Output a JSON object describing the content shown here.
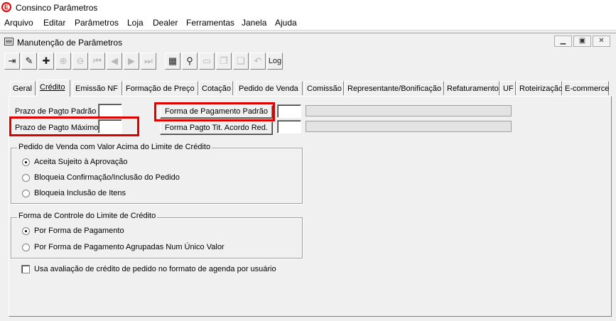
{
  "app": {
    "logo_letter": "E",
    "title": "Consinco Parâmetros"
  },
  "menu": [
    "Arquivo",
    "Editar",
    "Parâmetros",
    "Loja",
    "Dealer",
    "Ferramentas",
    "Janela",
    "Ajuda"
  ],
  "window": {
    "title": "Manutenção de Parâmetros",
    "minimize_glyph": "▁",
    "restore_glyph": "▣",
    "close_glyph": "✕"
  },
  "toolbar": {
    "log_label": "Log",
    "icons": [
      "exit-icon",
      "edit-icon",
      "new-icon",
      "insert-icon",
      "delete-icon",
      "first-icon",
      "previous-icon",
      "next-icon",
      "last-icon",
      "save-icon",
      "find-icon",
      "clear-icon",
      "copy-icon",
      "paste-icon",
      "undo-icon",
      "log-icon"
    ]
  },
  "tabs": [
    "Geral",
    "Crédito",
    "Emissão NF",
    "Formação de Preço",
    "Cotação",
    "Pedido de Venda",
    "Comissão",
    "Representante/Bonificação",
    "Refaturamento",
    "UF",
    "Roteirização",
    "E-commerce"
  ],
  "credit": {
    "prazo_padrao_label": "Prazo de Pagto Padrão",
    "prazo_maximo_label": "Prazo de Pagto Máximo",
    "prazo_padrao_value": "",
    "prazo_maximo_value": "",
    "forma_padrao_button": "Forma de Pagamento Padrão",
    "forma_acordo_button": "Forma Pagto Tit. Acordo Red.",
    "forma_padrao_code": "",
    "forma_acordo_code": "",
    "forma_padrao_desc": "",
    "forma_acordo_desc": ""
  },
  "group_pedido": {
    "title": "Pedido de Venda com Valor Acima do Limite de Crédito",
    "options": [
      "Aceita Sujeito à Aprovação",
      "Bloqueia Confirmação/Inclusão do Pedido",
      "Bloqueia Inclusão de Itens"
    ],
    "selected": 0
  },
  "group_controle": {
    "title": "Forma de Controle do Limite de Crédito",
    "options": [
      "Por Forma de Pagamento",
      "Por Forma de Pagamento Agrupadas Num Único Valor"
    ],
    "selected": 0
  },
  "agenda_checkbox": {
    "label": "Usa avaliação de crédito de pedido no formato de agenda por usuário",
    "checked": false
  },
  "colors": {
    "highlight": "#e00000",
    "background": "#f0f0f0"
  }
}
